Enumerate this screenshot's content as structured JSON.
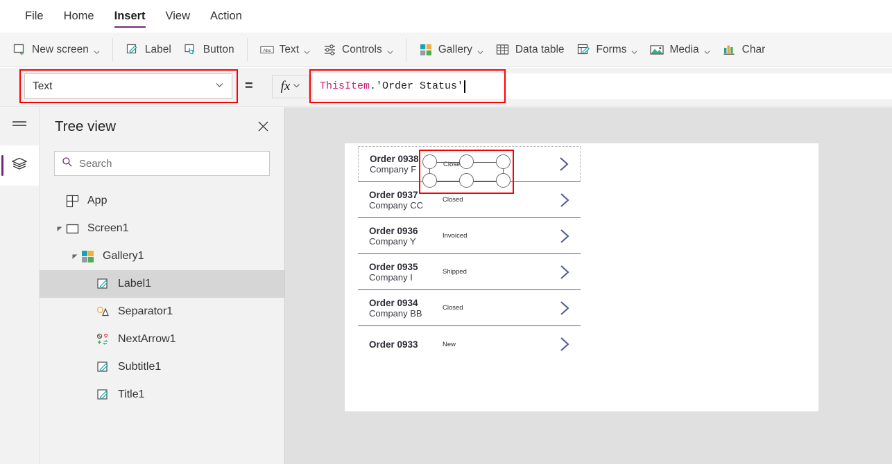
{
  "menu": {
    "items": [
      {
        "label": "File",
        "active": false
      },
      {
        "label": "Home",
        "active": false
      },
      {
        "label": "Insert",
        "active": true
      },
      {
        "label": "View",
        "active": false
      },
      {
        "label": "Action",
        "active": false
      }
    ]
  },
  "ribbon": {
    "items": [
      {
        "label": "New screen",
        "icon": "new-screen-icon",
        "chevron": true
      },
      {
        "label": "Label",
        "icon": "label-icon",
        "chevron": false
      },
      {
        "label": "Button",
        "icon": "button-icon",
        "chevron": false
      },
      {
        "label": "Text",
        "icon": "text-abc-icon",
        "chevron": true
      },
      {
        "label": "Controls",
        "icon": "controls-sliders-icon",
        "chevron": true
      },
      {
        "label": "Gallery",
        "icon": "gallery-squares-icon",
        "chevron": true
      },
      {
        "label": "Data table",
        "icon": "data-table-icon",
        "chevron": false
      },
      {
        "label": "Forms",
        "icon": "forms-icon",
        "chevron": true
      },
      {
        "label": "Media",
        "icon": "media-image-icon",
        "chevron": true
      },
      {
        "label": "Char",
        "icon": "charts-icon",
        "chevron": false
      }
    ]
  },
  "formula_bar": {
    "property_selected": "Text",
    "equals_symbol": "=",
    "fx_label": "fx",
    "formula_tokens": [
      {
        "text": "ThisItem",
        "type": "identifier"
      },
      {
        "text": ".'Order Status'",
        "type": "plain"
      }
    ],
    "formula_full": "ThisItem.'Order Status'"
  },
  "left_rail": {
    "hamburger": "hamburger-menu-icon",
    "active_tab": "tree-view-layers-icon"
  },
  "tree_view": {
    "title": "Tree view",
    "close_label": "×",
    "search_placeholder": "Search",
    "search_value": "",
    "items": [
      {
        "label": "App",
        "icon": "app-icon",
        "indent": 0,
        "caret": "none",
        "selected": false
      },
      {
        "label": "Screen1",
        "icon": "screen-icon",
        "indent": 0,
        "caret": "expanded",
        "selected": false
      },
      {
        "label": "Gallery1",
        "icon": "gallery-icon",
        "indent": 1,
        "caret": "expanded",
        "selected": false
      },
      {
        "label": "Label1",
        "icon": "label-edit-icon",
        "indent": 2,
        "caret": "none",
        "selected": true
      },
      {
        "label": "Separator1",
        "icon": "separator-icon",
        "indent": 2,
        "caret": "none",
        "selected": false
      },
      {
        "label": "NextArrow1",
        "icon": "next-arrow-icon",
        "indent": 2,
        "caret": "none",
        "selected": false
      },
      {
        "label": "Subtitle1",
        "icon": "label-edit-icon",
        "indent": 2,
        "caret": "none",
        "selected": false
      },
      {
        "label": "Title1",
        "icon": "label-edit-icon",
        "indent": 2,
        "caret": "none",
        "selected": false
      }
    ]
  },
  "canvas": {
    "gallery_rows": [
      {
        "title": "Order 0938",
        "subtitle": "Company F",
        "status": "Closed",
        "selected": true,
        "chevron": "chevron-right-icon",
        "clipped": false
      },
      {
        "title": "Order 0937",
        "subtitle": "Company CC",
        "status": "Closed",
        "selected": false,
        "chevron": "chevron-right-icon",
        "clipped": false
      },
      {
        "title": "Order 0936",
        "subtitle": "Company Y",
        "status": "Invoiced",
        "selected": false,
        "chevron": "chevron-right-icon",
        "clipped": false
      },
      {
        "title": "Order 0935",
        "subtitle": "Company I",
        "status": "Shipped",
        "selected": false,
        "chevron": "chevron-right-icon",
        "clipped": false
      },
      {
        "title": "Order 0934",
        "subtitle": "Company BB",
        "status": "Closed",
        "selected": false,
        "chevron": "chevron-right-icon",
        "clipped": false
      },
      {
        "title": "Order 0933",
        "subtitle": "",
        "status": "New",
        "selected": false,
        "chevron": "chevron-right-icon",
        "clipped": true
      }
    ]
  },
  "colors": {
    "accent_purple": "#742774",
    "annotation_red": "#ff0000",
    "chevron_blue": "#4f5b92",
    "formula_identifier": "#cc2277",
    "canvas_bg": "#e0e0e0",
    "panel_bg": "#f2f2f2",
    "selected_row_bg": "#d6d6d6"
  }
}
